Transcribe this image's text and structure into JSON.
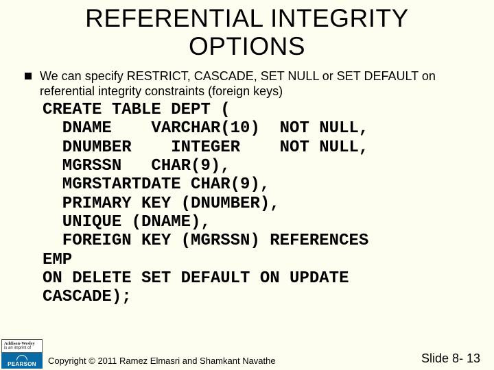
{
  "title_line1": "REFERENTIAL INTEGRITY",
  "title_line2": "OPTIONS",
  "bullet_text": "We can specify RESTRICT, CASCADE, SET NULL or SET DEFAULT on referential integrity constraints (foreign keys)",
  "code": "CREATE TABLE DEPT (\n  DNAME    VARCHAR(10)  NOT NULL,\n  DNUMBER    INTEGER    NOT NULL,\n  MGRSSN   CHAR(9),\n  MGRSTARTDATE CHAR(9),\n  PRIMARY KEY (DNUMBER),\n  UNIQUE (DNAME),\n  FOREIGN KEY (MGRSSN) REFERENCES\nEMP\nON DELETE SET DEFAULT ON UPDATE\nCASCADE);",
  "copyright": "Copyright © 2011 Ramez Elmasri and Shamkant Navathe",
  "slide_number": "Slide 8- 13",
  "logo": {
    "aw_brand": "Addison-Wesley",
    "aw_sub": "is an imprint of",
    "pearson": "PEARSON"
  }
}
